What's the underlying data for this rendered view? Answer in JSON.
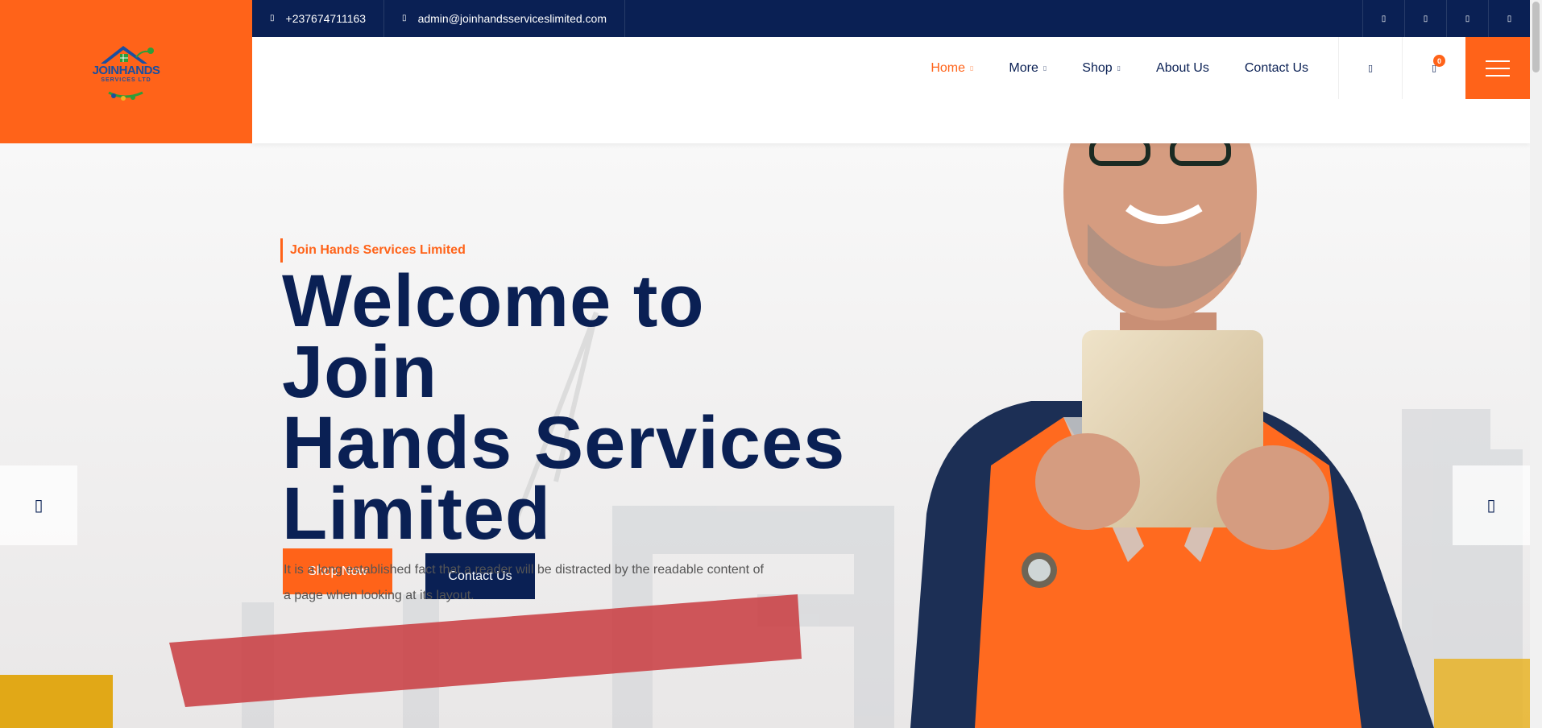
{
  "logo": {
    "text_line1": "JOINHANDS",
    "text_line2": "SERVICES LTD"
  },
  "topbar": {
    "phone_icon": "phone-icon",
    "phone": "+237674711163",
    "email_icon": "envelope-icon",
    "email": "admin@joinhandsserviceslimited.com",
    "social": [
      {
        "icon": "facebook-icon",
        "glyph": "▯"
      },
      {
        "icon": "twitter-icon",
        "glyph": "▯"
      },
      {
        "icon": "instagram-icon",
        "glyph": "▯"
      },
      {
        "icon": "linkedin-icon",
        "glyph": "▯"
      }
    ]
  },
  "nav": {
    "items": [
      {
        "label": "Home",
        "has_dropdown": true,
        "active": true
      },
      {
        "label": "More",
        "has_dropdown": true,
        "active": false
      },
      {
        "label": "Shop",
        "has_dropdown": true,
        "active": false
      },
      {
        "label": "About Us",
        "has_dropdown": false,
        "active": false
      },
      {
        "label": "Contact Us",
        "has_dropdown": false,
        "active": false
      }
    ],
    "dropdown_glyph": "▯",
    "search_icon": "search-icon",
    "search_glyph": "▯",
    "cart_icon": "cart-icon",
    "cart_glyph": "▯",
    "cart_count": "0",
    "menu_icon": "hamburger-icon"
  },
  "hero": {
    "eyebrow": "Join Hands Services Limited",
    "title_lines": [
      "Welcome to Join",
      "Hands Services",
      "Limited"
    ],
    "description": "It is a long established fact that a reader will be distracted by the readable content of a page when looking at its layout.",
    "shop_button": "Shop Now",
    "contact_button": "Contact Us",
    "prev_glyph": "▯",
    "next_glyph": "▯"
  },
  "colors": {
    "accent": "#ff6319",
    "navy": "#0a2054",
    "vest_orange": "#ff6a1f",
    "shirt": "#1c2f55"
  }
}
